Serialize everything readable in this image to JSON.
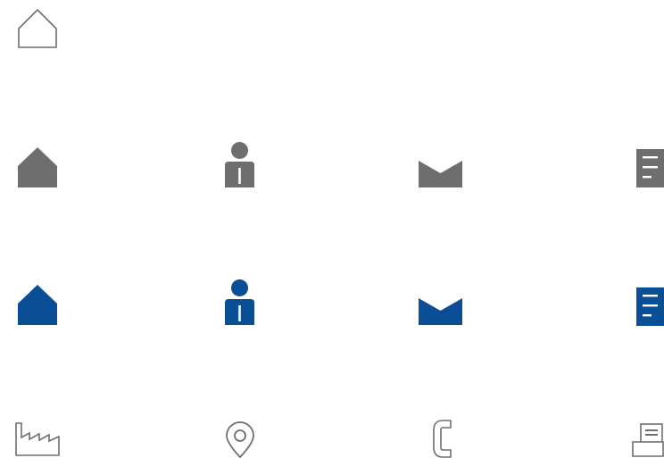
{
  "colors": {
    "grey": "#6e6e6e",
    "blue": "#0a4f95",
    "outline": "#6e6e6e",
    "background": "#ffffff"
  },
  "rows": [
    {
      "name": "outline-top",
      "icons": [
        "home-outline-icon"
      ]
    },
    {
      "name": "grey-filled",
      "icons": [
        "home-icon",
        "person-icon",
        "mail-icon",
        "document-icon"
      ]
    },
    {
      "name": "blue-filled",
      "icons": [
        "home-icon",
        "person-icon",
        "mail-icon",
        "document-icon"
      ]
    },
    {
      "name": "outline-bottom",
      "icons": [
        "factory-icon",
        "location-pin-icon",
        "phone-icon",
        "fax-icon"
      ]
    }
  ]
}
